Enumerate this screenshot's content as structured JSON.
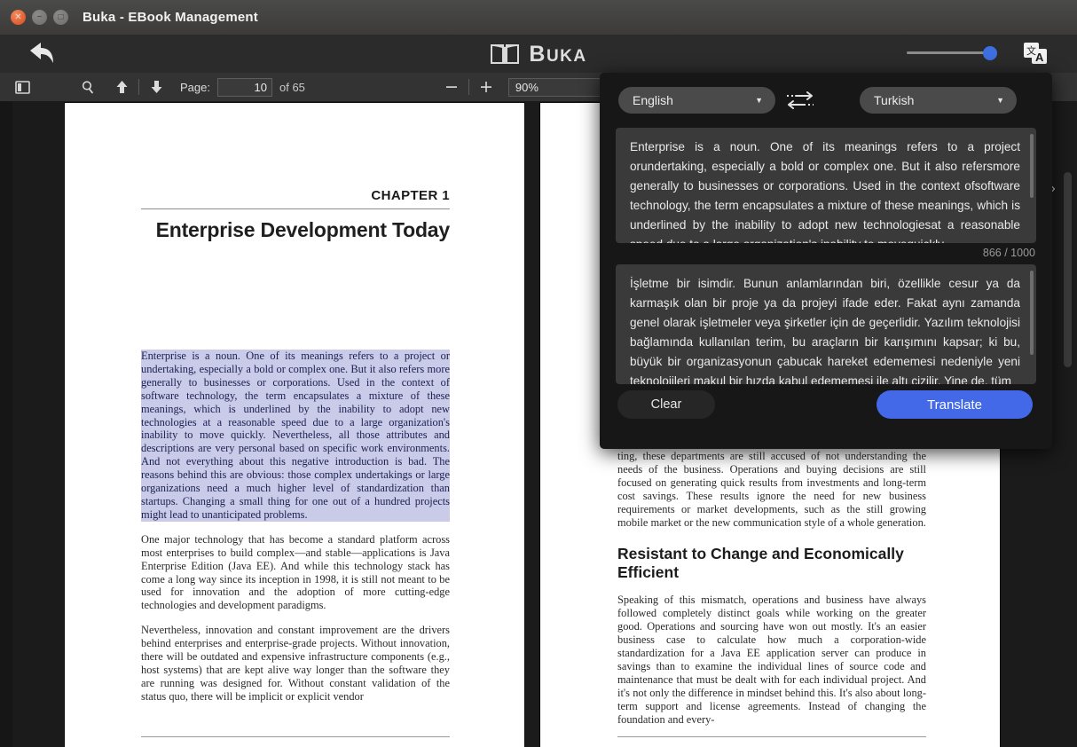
{
  "window": {
    "title": "Buka - EBook Management",
    "controls": {
      "close": "close-button",
      "minimize": "minimize-button",
      "maximize": "maximize-button"
    }
  },
  "header": {
    "brand_first": "B",
    "brand_rest": "UKA",
    "brand_full": "BUKA",
    "back_label": "Back",
    "slider_value": 86,
    "translate_icon_label": "Translate"
  },
  "toolbar": {
    "sidebar_toggle": "Toggle sidebar",
    "search": "Search",
    "prev_page": "Previous page",
    "next_page": "Next page",
    "page_label": "Page:",
    "page_value": "10",
    "page_of": "of 65",
    "zoom_out": "−",
    "zoom_in": "+",
    "zoom_value": "90%"
  },
  "translate_panel": {
    "source_language": "English",
    "target_language": "Turkish",
    "swap_label": "Swap languages",
    "source_text": "Enterprise is a noun. One of its meanings refers to a project orundertaking, especially a bold or complex one. But it also refersmore generally to businesses or corporations. Used in the context ofsoftware technology, the term encapsulates a mixture of these meanings, which is underlined by the inability to adopt new technologiesat a reasonable speed due to a large organization's inability to movequickly.",
    "counter": "866 / 1000",
    "target_text": "İşletme bir isimdir. Bunun anlamlarından biri, özellikle cesur ya da karmaşık olan bir proje ya da projeyi ifade eder. Fakat aynı zamanda genel olarak işletmeler veya şirketler için de geçerlidir. Yazılım teknolojisi bağlamında kullanılan terim, bu araçların bir karışımını kapsar; ki bu, büyük bir organizasyonun çabucak hareket edememesi nedeniyle yeni teknolojileri makul bir hızda kabul edememesi ile altı çizilir. Yine de, tüm",
    "clear_label": "Clear",
    "translate_label": "Translate"
  },
  "book": {
    "left_page": {
      "chapter_label": "CHAPTER 1",
      "chapter_title": "Enterprise Development Today",
      "paragraphs": [
        "Enterprise is a noun. One of its meanings refers to a project or undertaking, especially a bold or complex one. But it also refers more generally to businesses or corporations. Used in the context of software technology, the term encapsulates a mixture of these meanings, which is underlined by the inability to adopt new technologies at a reasonable speed due to a large organization's inability to move quickly. Nevertheless, all those attributes and descriptions are very personal based on specific work environments. And not everything about this negative introduction is bad. The reasons behind this are obvious: those complex undertakings or large organizations need a much higher level of standardization than startups. Changing a small thing for one out of a hundred projects might lead to unanticipated problems.",
        "One major technology that has become a standard platform across most enterprises to build complex—and stable—applications is Java Enterprise Edition (Java EE). And while this technology stack has come a long way since its inception in 1998, it is still not meant to be used for innovation and the adoption of more cutting-edge technologies and development paradigms.",
        "Nevertheless, innovation and constant improvement are the drivers behind enterprises and enterprise-grade projects. Without innovation, there will be outdated and expensive infrastructure components (e.g., host systems) that are kept alive way longer than the software they are running was designed for. Without constant validation of the status quo, there will be implicit or explicit vendor"
      ]
    },
    "right_page": {
      "paragraph_top": "ting, these departments are still accused of not understanding the needs of the business. Operations and buying decisions are still focused on generating quick results from investments and long-term cost savings. These results ignore the need for new business requirements or market developments, such as the still growing mobile market or the new communication style of a whole generation.",
      "section_heading": "Resistant to Change and Economically Efficient",
      "paragraph_bottom": "Speaking of this mismatch, operations and business have always followed completely distinct goals while working on the greater good. Operations and sourcing have won out mostly. It's an easier business case to calculate how much a corporation-wide standardization for a Java EE application server can produce in savings than to examine the individual lines of source code and maintenance that must be dealt with for each individual project. And it's not only the difference in mindset behind this. It's also about long-term support and license agreements. Instead of changing the foundation and every-"
    }
  },
  "colors": {
    "accent_blue": "#4369e8",
    "slider_blue": "#3d6fe0",
    "selection_highlight": "#c9cbe8",
    "panel_bg": "#171717",
    "toolbar_bg": "#333333"
  },
  "misc": {
    "expand_chevron": "›"
  }
}
